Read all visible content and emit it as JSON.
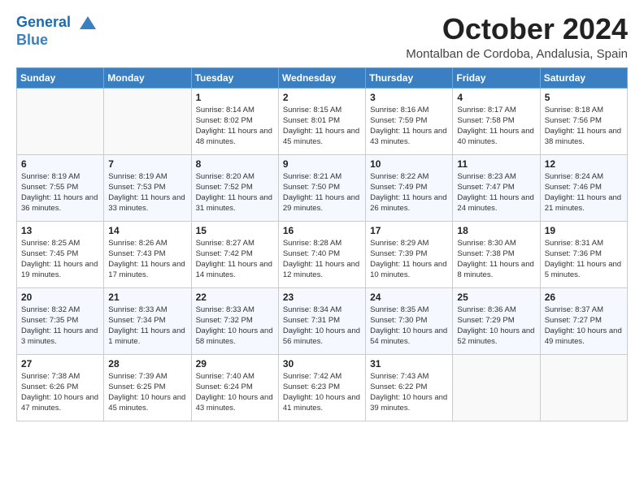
{
  "logo": {
    "line1": "General",
    "line2": "Blue"
  },
  "title": "October 2024",
  "location": "Montalban de Cordoba, Andalusia, Spain",
  "headers": [
    "Sunday",
    "Monday",
    "Tuesday",
    "Wednesday",
    "Thursday",
    "Friday",
    "Saturday"
  ],
  "weeks": [
    [
      {
        "day": "",
        "info": ""
      },
      {
        "day": "",
        "info": ""
      },
      {
        "day": "1",
        "info": "Sunrise: 8:14 AM\nSunset: 8:02 PM\nDaylight: 11 hours and 48 minutes."
      },
      {
        "day": "2",
        "info": "Sunrise: 8:15 AM\nSunset: 8:01 PM\nDaylight: 11 hours and 45 minutes."
      },
      {
        "day": "3",
        "info": "Sunrise: 8:16 AM\nSunset: 7:59 PM\nDaylight: 11 hours and 43 minutes."
      },
      {
        "day": "4",
        "info": "Sunrise: 8:17 AM\nSunset: 7:58 PM\nDaylight: 11 hours and 40 minutes."
      },
      {
        "day": "5",
        "info": "Sunrise: 8:18 AM\nSunset: 7:56 PM\nDaylight: 11 hours and 38 minutes."
      }
    ],
    [
      {
        "day": "6",
        "info": "Sunrise: 8:19 AM\nSunset: 7:55 PM\nDaylight: 11 hours and 36 minutes."
      },
      {
        "day": "7",
        "info": "Sunrise: 8:19 AM\nSunset: 7:53 PM\nDaylight: 11 hours and 33 minutes."
      },
      {
        "day": "8",
        "info": "Sunrise: 8:20 AM\nSunset: 7:52 PM\nDaylight: 11 hours and 31 minutes."
      },
      {
        "day": "9",
        "info": "Sunrise: 8:21 AM\nSunset: 7:50 PM\nDaylight: 11 hours and 29 minutes."
      },
      {
        "day": "10",
        "info": "Sunrise: 8:22 AM\nSunset: 7:49 PM\nDaylight: 11 hours and 26 minutes."
      },
      {
        "day": "11",
        "info": "Sunrise: 8:23 AM\nSunset: 7:47 PM\nDaylight: 11 hours and 24 minutes."
      },
      {
        "day": "12",
        "info": "Sunrise: 8:24 AM\nSunset: 7:46 PM\nDaylight: 11 hours and 21 minutes."
      }
    ],
    [
      {
        "day": "13",
        "info": "Sunrise: 8:25 AM\nSunset: 7:45 PM\nDaylight: 11 hours and 19 minutes."
      },
      {
        "day": "14",
        "info": "Sunrise: 8:26 AM\nSunset: 7:43 PM\nDaylight: 11 hours and 17 minutes."
      },
      {
        "day": "15",
        "info": "Sunrise: 8:27 AM\nSunset: 7:42 PM\nDaylight: 11 hours and 14 minutes."
      },
      {
        "day": "16",
        "info": "Sunrise: 8:28 AM\nSunset: 7:40 PM\nDaylight: 11 hours and 12 minutes."
      },
      {
        "day": "17",
        "info": "Sunrise: 8:29 AM\nSunset: 7:39 PM\nDaylight: 11 hours and 10 minutes."
      },
      {
        "day": "18",
        "info": "Sunrise: 8:30 AM\nSunset: 7:38 PM\nDaylight: 11 hours and 8 minutes."
      },
      {
        "day": "19",
        "info": "Sunrise: 8:31 AM\nSunset: 7:36 PM\nDaylight: 11 hours and 5 minutes."
      }
    ],
    [
      {
        "day": "20",
        "info": "Sunrise: 8:32 AM\nSunset: 7:35 PM\nDaylight: 11 hours and 3 minutes."
      },
      {
        "day": "21",
        "info": "Sunrise: 8:33 AM\nSunset: 7:34 PM\nDaylight: 11 hours and 1 minute."
      },
      {
        "day": "22",
        "info": "Sunrise: 8:33 AM\nSunset: 7:32 PM\nDaylight: 10 hours and 58 minutes."
      },
      {
        "day": "23",
        "info": "Sunrise: 8:34 AM\nSunset: 7:31 PM\nDaylight: 10 hours and 56 minutes."
      },
      {
        "day": "24",
        "info": "Sunrise: 8:35 AM\nSunset: 7:30 PM\nDaylight: 10 hours and 54 minutes."
      },
      {
        "day": "25",
        "info": "Sunrise: 8:36 AM\nSunset: 7:29 PM\nDaylight: 10 hours and 52 minutes."
      },
      {
        "day": "26",
        "info": "Sunrise: 8:37 AM\nSunset: 7:27 PM\nDaylight: 10 hours and 49 minutes."
      }
    ],
    [
      {
        "day": "27",
        "info": "Sunrise: 7:38 AM\nSunset: 6:26 PM\nDaylight: 10 hours and 47 minutes."
      },
      {
        "day": "28",
        "info": "Sunrise: 7:39 AM\nSunset: 6:25 PM\nDaylight: 10 hours and 45 minutes."
      },
      {
        "day": "29",
        "info": "Sunrise: 7:40 AM\nSunset: 6:24 PM\nDaylight: 10 hours and 43 minutes."
      },
      {
        "day": "30",
        "info": "Sunrise: 7:42 AM\nSunset: 6:23 PM\nDaylight: 10 hours and 41 minutes."
      },
      {
        "day": "31",
        "info": "Sunrise: 7:43 AM\nSunset: 6:22 PM\nDaylight: 10 hours and 39 minutes."
      },
      {
        "day": "",
        "info": ""
      },
      {
        "day": "",
        "info": ""
      }
    ]
  ]
}
